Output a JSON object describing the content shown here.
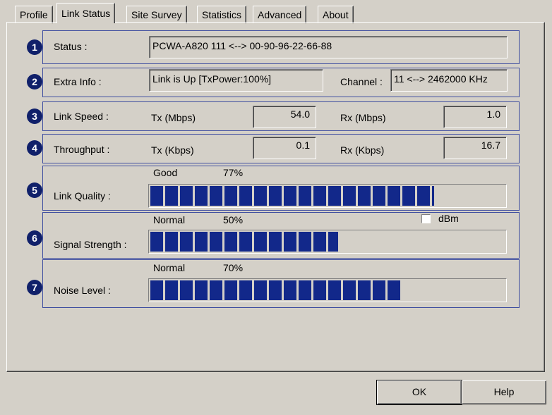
{
  "tabs": [
    "Profile",
    "Link Status",
    "Site Survey",
    "Statistics",
    "Advanced",
    "About"
  ],
  "active_tab": "Link Status",
  "status": {
    "num": "1",
    "label": "Status :",
    "value": "PCWA-A820 111 <--> 00-90-96-22-66-88"
  },
  "extra": {
    "num": "2",
    "label": "Extra Info :",
    "value": "Link is Up [TxPower:100%]",
    "channel_label": "Channel :",
    "channel_value": "11 <--> 2462000 KHz"
  },
  "link_speed": {
    "num": "3",
    "label": "Link Speed :",
    "tx_label": "Tx (Mbps)",
    "tx_value": "54.0",
    "rx_label": "Rx (Mbps)",
    "rx_value": "1.0"
  },
  "throughput": {
    "num": "4",
    "label": "Throughput :",
    "tx_label": "Tx (Kbps)",
    "tx_value": "0.1",
    "rx_label": "Rx (Kbps)",
    "rx_value": "16.7"
  },
  "link_quality": {
    "num": "5",
    "label": "Link Quality :",
    "rating": "Good",
    "percent": "77%",
    "level": 0.8
  },
  "signal_strength": {
    "num": "6",
    "label": "Signal Strength :",
    "rating": "Normal",
    "percent": "50%",
    "level": 0.53,
    "dbm_label": "dBm",
    "dbm_checked": false
  },
  "noise_level": {
    "num": "7",
    "label": "Noise Level :",
    "rating": "Normal",
    "percent": "70%",
    "level": 0.71
  },
  "buttons": {
    "ok": "OK",
    "help": "Help"
  },
  "colors": {
    "bar": "#12288a",
    "group_border": "#3f4ea0",
    "badge": "#10206a"
  }
}
